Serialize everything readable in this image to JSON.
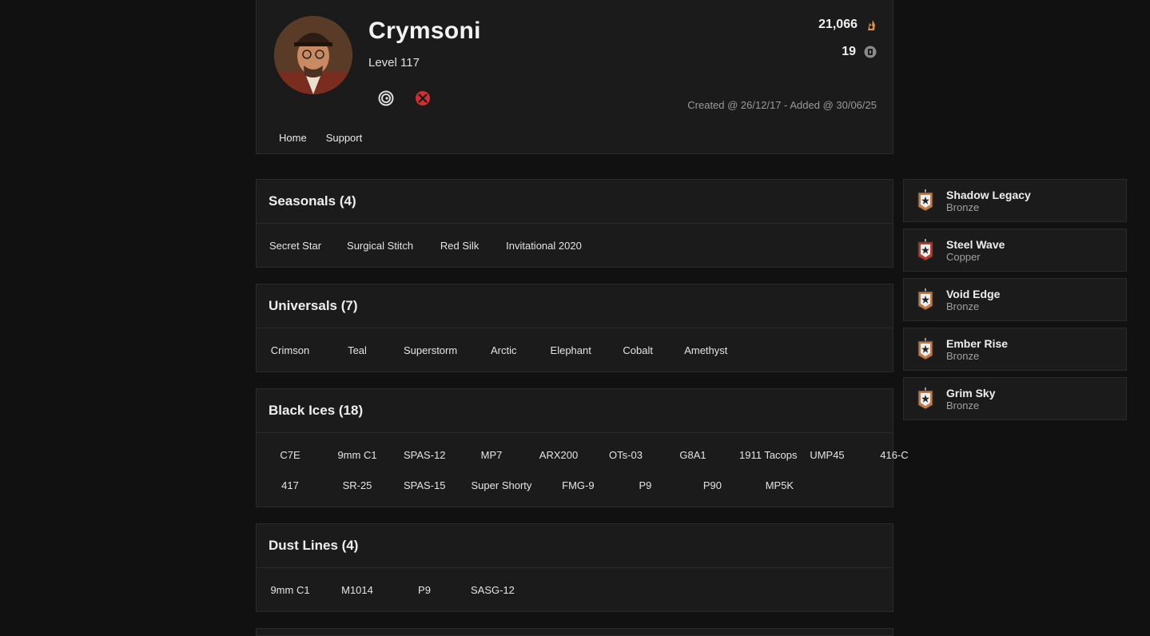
{
  "profile": {
    "username": "Crymsoni",
    "level": "Level 117",
    "renown": "21,066",
    "credits": "19",
    "created": "Created @ 26/12/17 - Added @ 30/06/25",
    "platforms": [
      "ubisoft-icon",
      "xbox-icon"
    ],
    "xbox_color": "#d32f2f"
  },
  "nav": {
    "home": "Home",
    "support": "Support"
  },
  "seasonals": {
    "title": "Seasonals (4)",
    "items": [
      "Secret Star",
      "Surgical Stitch",
      "Red Silk",
      "Invitational 2020"
    ]
  },
  "universals": {
    "title": "Universals (7)",
    "items": [
      "Crimson",
      "Teal",
      "Superstorm",
      "Arctic",
      "Elephant",
      "Cobalt",
      "Amethyst"
    ]
  },
  "black_ices": {
    "title": "Black Ices (18)",
    "row1": [
      "C7E",
      "9mm C1",
      "SPAS-12",
      "MP7",
      "ARX200",
      "OTs-03",
      "G8A1",
      "1911 Tacops",
      "UMP45",
      "416-C"
    ],
    "row2": [
      "417",
      "SR-25",
      "SPAS-15",
      "Super Shorty",
      "FMG-9",
      "P9",
      "P90",
      "MP5K"
    ]
  },
  "dust_lines": {
    "title": "Dust Lines (4)",
    "items": [
      "9mm C1",
      "M1014",
      "P9",
      "SASG-12"
    ]
  },
  "ranks": [
    {
      "name": "Shadow Legacy",
      "tier": "Bronze",
      "color": "#c77a42"
    },
    {
      "name": "Steel Wave",
      "tier": "Copper",
      "color": "#c0392b"
    },
    {
      "name": "Void Edge",
      "tier": "Bronze",
      "color": "#c77a42"
    },
    {
      "name": "Ember Rise",
      "tier": "Bronze",
      "color": "#c77a42"
    },
    {
      "name": "Grim Sky",
      "tier": "Bronze",
      "color": "#c77a42"
    }
  ]
}
